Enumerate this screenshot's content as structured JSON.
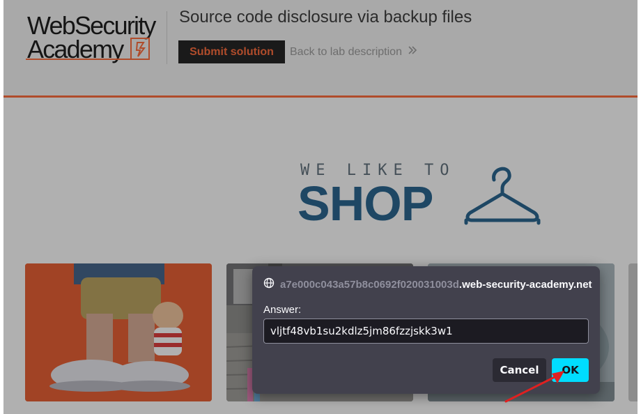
{
  "header": {
    "logo_line1": "WebSecurity",
    "logo_line2": "Academy",
    "lab_title": "Source code disclosure via backup files",
    "submit_label": "Submit solution",
    "back_label": "Back to lab description",
    "back_icon": "double-chevron-right-icon"
  },
  "banner": {
    "tagline": "WE LIKE TO",
    "word": "SHOP",
    "icon": "hanger-icon"
  },
  "products": [
    {
      "name": "product-card-1"
    },
    {
      "name": "product-card-2"
    },
    {
      "name": "product-card-3"
    },
    {
      "name": "product-card-4"
    }
  ],
  "dialog": {
    "origin_faded": "a7e000c043a57b8c0692f020031003d",
    "origin_domain": ".web-security-academy.net",
    "origin_icon": "globe-icon",
    "label": "Answer:",
    "input_value": "vljtf48vb1su2kdlz5jm86fzzjskk3w1",
    "cancel_label": "Cancel",
    "ok_label": "OK"
  },
  "colors": {
    "brand_orange": "#ff6633",
    "shop_blue": "#1f5f8b",
    "ok_accent": "#00ddff",
    "annotation_arrow": "#e02020"
  }
}
